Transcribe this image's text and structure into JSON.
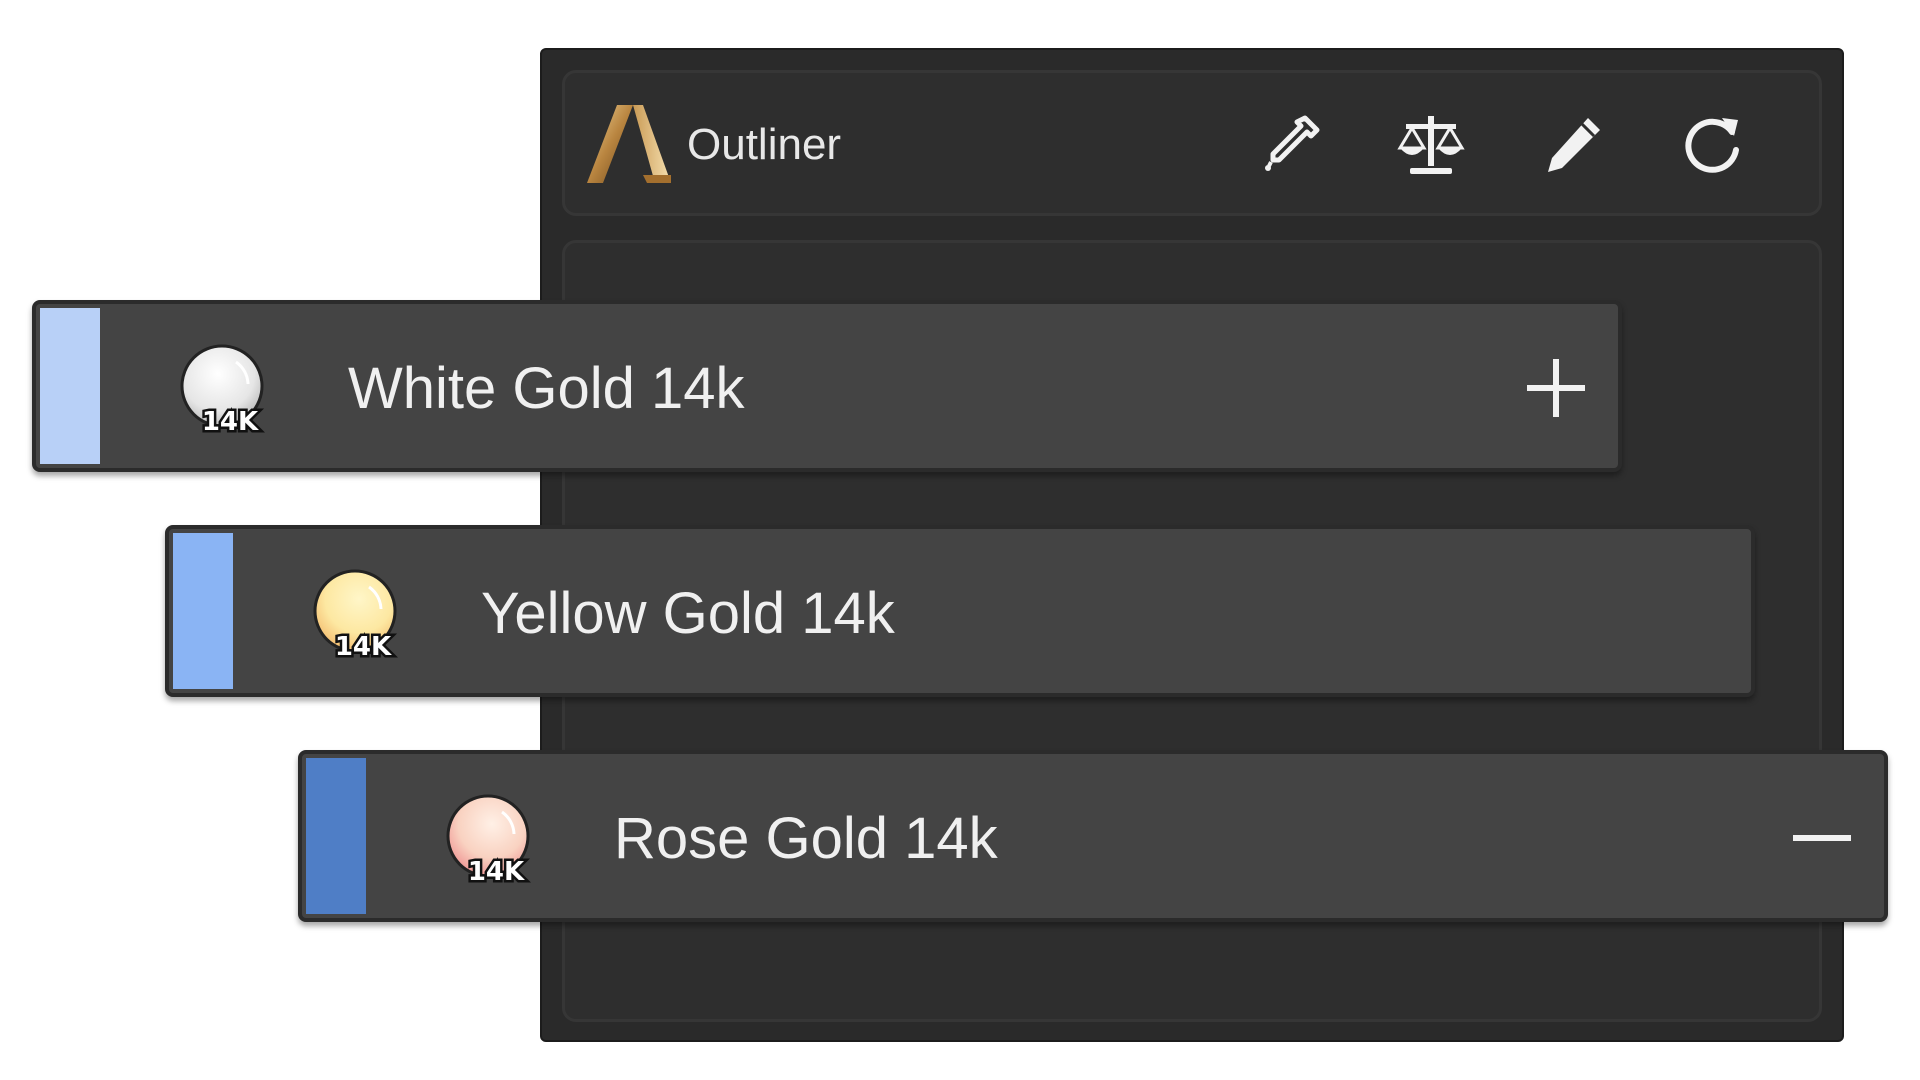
{
  "window": {
    "title": "Outliner"
  },
  "toolbar": {
    "tools": [
      {
        "icon": "eyedropper-icon"
      },
      {
        "icon": "scale-icon"
      },
      {
        "icon": "pencil-icon"
      },
      {
        "icon": "refresh-icon"
      }
    ]
  },
  "materials": [
    {
      "name": "White Gold 14k",
      "badge": "14K",
      "swatch_color": "#b8d0f7",
      "sphere_color": "#f0f0f0",
      "action": "plus-icon"
    },
    {
      "name": "Yellow Gold 14k",
      "badge": "14K",
      "swatch_color": "#8ab4f4",
      "sphere_color": "#fde8a2",
      "action": null
    },
    {
      "name": "Rose Gold 14k",
      "badge": "14K",
      "swatch_color": "#4f7ec6",
      "sphere_color": "#f9d2c1",
      "action": "minus-icon"
    }
  ],
  "colors": {
    "panel_bg": "#2a2a2a",
    "row_bg": "#444444",
    "text": "#f0f0f0"
  }
}
